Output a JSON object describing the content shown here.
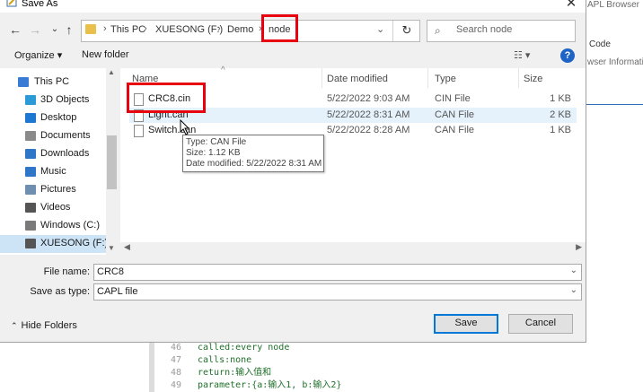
{
  "background_app": {
    "panel_title": "APL Browser",
    "code_label": "Code",
    "info_label": "wser Informatio",
    "code_lines": [
      {
        "num": "46",
        "text": "called:every node"
      },
      {
        "num": "47",
        "text": "calls:none"
      },
      {
        "num": "48",
        "text": "return:输入值和"
      },
      {
        "num": "49",
        "text": "parameter:{a:输入1, b:输入2}"
      }
    ]
  },
  "dialog": {
    "title": "Save As",
    "close_glyph": "✕",
    "nav": {
      "back": "←",
      "forward": "→",
      "recent": "⌄",
      "up": "↑",
      "refresh": "↻"
    },
    "address": {
      "segments": [
        "This PC",
        "XUESONG (F:)",
        "Demo",
        "node"
      ],
      "separator": "›",
      "dropdown": "⌄"
    },
    "search": {
      "placeholder": "Search node",
      "icon": "⌕"
    },
    "toolbar": {
      "organize": "Organize ▾",
      "new_folder": "New folder",
      "view": "☷ ▾",
      "help": "?"
    },
    "nav_pane": [
      {
        "label": "This PC",
        "icon": "this-pc-icon",
        "color": "#3a7bd5"
      },
      {
        "label": "3D Objects",
        "icon": "3d-objects-icon",
        "color": "#2b9ad6"
      },
      {
        "label": "Desktop",
        "icon": "desktop-icon",
        "color": "#1e78d2"
      },
      {
        "label": "Documents",
        "icon": "documents-icon",
        "color": "#8a8a8a"
      },
      {
        "label": "Downloads",
        "icon": "downloads-icon",
        "color": "#2e76c8"
      },
      {
        "label": "Music",
        "icon": "music-icon",
        "color": "#2e76c8"
      },
      {
        "label": "Pictures",
        "icon": "pictures-icon",
        "color": "#6e8fb0"
      },
      {
        "label": "Videos",
        "icon": "videos-icon",
        "color": "#555555"
      },
      {
        "label": "Windows (C:)",
        "icon": "drive-icon",
        "color": "#7a7a7a"
      },
      {
        "label": "XUESONG (F:)",
        "icon": "drive-icon",
        "color": "#555555",
        "selected": true
      }
    ],
    "columns": {
      "name": "Name",
      "date": "Date modified",
      "type": "Type",
      "size": "Size",
      "sort_glyph": "^"
    },
    "files": [
      {
        "name": "CRC8.cin",
        "date": "5/22/2022 9:03 AM",
        "type": "CIN File",
        "size": "1 KB"
      },
      {
        "name": "Light.can",
        "date": "5/22/2022 8:31 AM",
        "type": "CAN File",
        "size": "2 KB",
        "hover": true
      },
      {
        "name": "Switch.can",
        "date": "5/22/2022 8:28 AM",
        "type": "CAN File",
        "size": "1 KB"
      }
    ],
    "tooltip": {
      "type": "Type: CAN File",
      "size": "Size: 1.12 KB",
      "modified": "Date modified: 5/22/2022 8:31 AM"
    },
    "form": {
      "file_name_label": "File name:",
      "file_name_value": "CRC8",
      "save_type_label": "Save as type:",
      "save_type_value": "CAPL file"
    },
    "hide_folders": "Hide Folders",
    "save_label": "Save",
    "cancel_label": "Cancel"
  },
  "colors": {
    "highlight_red": "#e8000f",
    "accent_blue": "#0078d7"
  }
}
